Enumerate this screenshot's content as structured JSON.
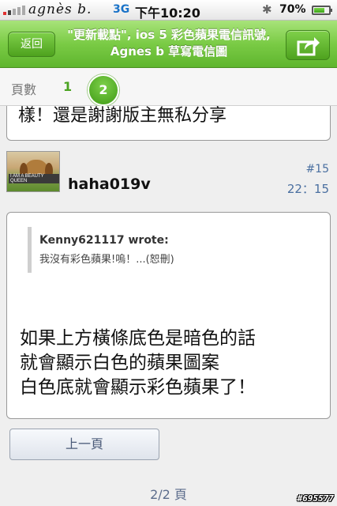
{
  "status_bar": {
    "carrier": "agnès b.",
    "network": "3G",
    "time": "下午10:20",
    "battery": "70%",
    "battery_level": 0.7
  },
  "nav": {
    "back_label": "返回",
    "title": "\"更新載點\", ios 5 彩色蘋果電信訊號, Agnes b 草寫電信圖"
  },
  "pager": {
    "label": "頁數",
    "pages": [
      "1",
      "2"
    ],
    "current": "2"
  },
  "previous_post": {
    "tail_text": "樣！還是謝謝版主無私分享"
  },
  "post": {
    "username": "haha019v",
    "number": "#15",
    "time": "22：15",
    "avatar_caption": "I AM A BEAUTY QUEEN",
    "quote": {
      "author": "Kenny621117 wrote:",
      "text": "我沒有彩色蘋果!嗚！...(恕刪)"
    },
    "lines": [
      "如果上方橫條底色是暗色的話",
      "就會顯示白色的蘋果圖案",
      "白色底就會顯示彩色蘋果了！"
    ]
  },
  "footer": {
    "prev_page_label": "上一頁",
    "page_indicator": "2/2 頁",
    "watermark": "#695577"
  }
}
